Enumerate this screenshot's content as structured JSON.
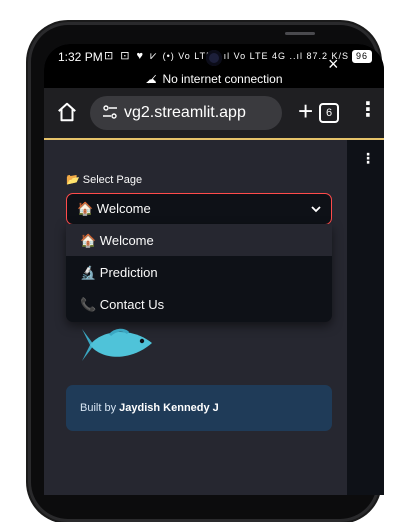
{
  "statusbar": {
    "time": "1:32 PM",
    "status_icons": "⊡ ⊡ ♥ ⩗",
    "network": "(•) Vo LTE ..ıl Vo LTE 4G ..ıl 87.2 K/S",
    "battery": "96"
  },
  "offline_banner": {
    "text": "No internet connection"
  },
  "browser": {
    "url": "vg2.streamlit.app",
    "tab_count": "6",
    "plus": "+",
    "menu": "⋮"
  },
  "sidebar": {
    "close": "×",
    "select_label": "📂 Select Page",
    "selected_value": "🏠 Welcome",
    "options": [
      {
        "label": "🏠 Welcome"
      },
      {
        "label": "🔬 Prediction"
      },
      {
        "label": "📞 Contact Us"
      }
    ],
    "built_by_prefix": "Built by ",
    "built_by_name": "Jaydish Kennedy J"
  },
  "main": {
    "menu": "⋮"
  },
  "colors": {
    "accent": "#ff4b4b",
    "sidebar_bg": "#262730",
    "app_bg": "#0e1117",
    "info_bg": "#1f3b58",
    "toolbar_accent": "#e6c36a",
    "fish": "#4fc3d9"
  }
}
